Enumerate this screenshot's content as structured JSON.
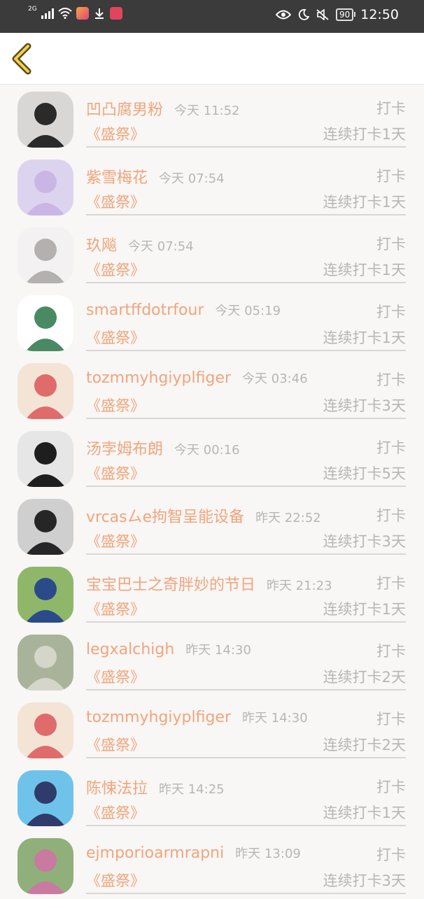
{
  "status_bar": {
    "network": "2G",
    "battery": "90",
    "time": "12:50"
  },
  "entries": [
    {
      "name": "凹凸腐男粉",
      "time": "今天 11:52",
      "action": "打卡",
      "book": "《盛祭》",
      "streak": "连续打卡1天",
      "avatar": {
        "bg": "#d9d6d6",
        "fg": "#2a2a2a"
      }
    },
    {
      "name": "紫雪梅花",
      "time": "今天 07:54",
      "action": "打卡",
      "book": "《盛祭》",
      "streak": "连续打卡1天",
      "avatar": {
        "bg": "#dcd4ee",
        "fg": "#c9b6e4"
      }
    },
    {
      "name": "玖飚",
      "time": "今天 07:54",
      "action": "打卡",
      "book": "《盛祭》",
      "streak": "连续打卡1天",
      "avatar": {
        "bg": "#f3f1f1",
        "fg": "#b4b0b0"
      }
    },
    {
      "name": "smartffdotrfour",
      "time": "今天 05:19",
      "action": "打卡",
      "book": "《盛祭》",
      "streak": "连续打卡1天",
      "avatar": {
        "bg": "#ffffff",
        "fg": "#4a8a62"
      }
    },
    {
      "name": "tozmmyhgiyplfiger",
      "time": "今天 03:46",
      "action": "打卡",
      "book": "《盛祭》",
      "streak": "连续打卡3天",
      "avatar": {
        "bg": "#f3e4d6",
        "fg": "#e06b6b"
      }
    },
    {
      "name": "汤孛姆布朗",
      "time": "今天 00:16",
      "action": "打卡",
      "book": "《盛祭》",
      "streak": "连续打卡5天",
      "avatar": {
        "bg": "#e6e6e6",
        "fg": "#1e1e1e"
      }
    },
    {
      "name": "vrcasㄙe拘智呈能设备",
      "time": "昨天 22:52",
      "action": "打卡",
      "book": "《盛祭》",
      "streak": "连续打卡3天",
      "avatar": {
        "bg": "#cfcfcf",
        "fg": "#262626"
      }
    },
    {
      "name": "宝宝巴士之奇胖妙的节日",
      "time": "昨天 21:23",
      "action": "打卡",
      "book": "《盛祭》",
      "streak": "连续打卡1天",
      "avatar": {
        "bg": "#8fb76a",
        "fg": "#2a4a8a"
      }
    },
    {
      "name": "legxalchigh",
      "time": "昨天 14:30",
      "action": "打卡",
      "book": "《盛祭》",
      "streak": "连续打卡2天",
      "avatar": {
        "bg": "#a9b39a",
        "fg": "#d3d6c9"
      }
    },
    {
      "name": "tozmmyhgiyplfiger",
      "time": "昨天 14:30",
      "action": "打卡",
      "book": "《盛祭》",
      "streak": "连续打卡2天",
      "avatar": {
        "bg": "#f3e4d6",
        "fg": "#e06b6b"
      }
    },
    {
      "name": "陈悚法拉",
      "time": "昨天 14:25",
      "action": "打卡",
      "book": "《盛祭》",
      "streak": "连续打卡1天",
      "avatar": {
        "bg": "#6fc3ea",
        "fg": "#2f3b6b"
      }
    },
    {
      "name": "ejmporioarmrapni",
      "time": "昨天 13:09",
      "action": "打卡",
      "book": "《盛祭》",
      "streak": "连续打卡3天",
      "avatar": {
        "bg": "#8fb07a",
        "fg": "#c87aa0"
      }
    }
  ]
}
